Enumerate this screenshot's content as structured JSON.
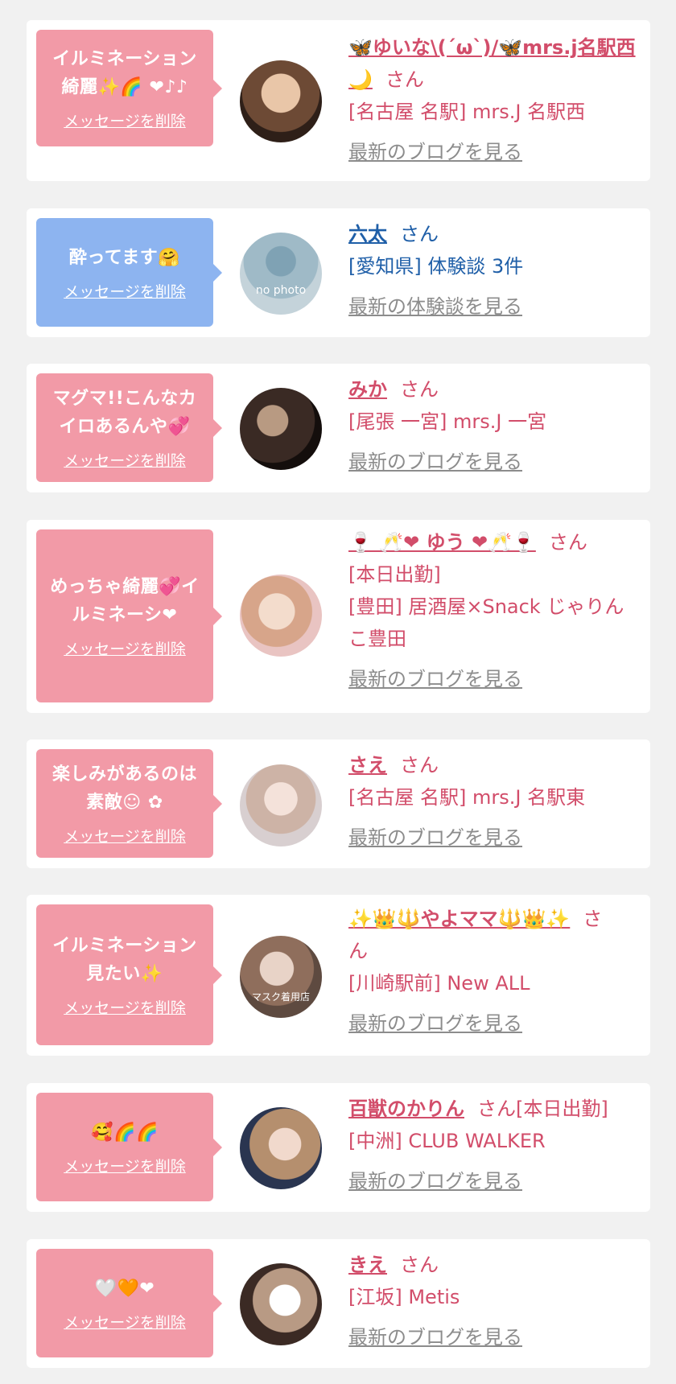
{
  "delete_label": "メッセージを削除",
  "items": [
    {
      "message": "イルミネーション綺麗✨🌈 ❤♪♪",
      "name": "🦋ゆいな\\(´ω`)/🦋mrs.j名駅西🌙",
      "san": "さん",
      "lines": [
        "[名古屋 名駅] mrs.J 名駅西"
      ],
      "link": "最新のブログを見る"
    },
    {
      "message": "酔ってます🤗",
      "name": "六太",
      "san": "さん",
      "lines": [
        "[愛知県] 体験談 3件"
      ],
      "link": "最新の体験談を見る",
      "avatar_text": "no photo"
    },
    {
      "message": "マグマ!!こんなカイロあるんや💞",
      "name": "みか",
      "san": "さん",
      "lines": [
        "[尾張 一宮] mrs.J 一宮"
      ],
      "link": "最新のブログを見る"
    },
    {
      "message": "めっちゃ綺麗💞イルミネーシ❤",
      "name": "🍷 🥂❤ ゆう ❤🥂🍷",
      "san": "さん",
      "lines": [
        "[本日出勤]",
        "[豊田] 居酒屋×Snack じゃりん",
        "こ豊田"
      ],
      "link": "最新のブログを見る"
    },
    {
      "message": "楽しみがあるのは素敵☺ ✿",
      "name": "さえ",
      "san": "さん",
      "lines": [
        "[名古屋 名駅] mrs.J 名駅東"
      ],
      "link": "最新のブログを見る"
    },
    {
      "message": "イルミネーション見たい✨",
      "name": "✨👑🔱やよママ🔱👑✨",
      "san": "さ",
      "san2": "ん",
      "lines": [
        "[川崎駅前] New ALL"
      ],
      "link": "最新のブログを見る",
      "avatar_text": "マスク着用店"
    },
    {
      "message": "🥰🌈🌈",
      "name": "百獣のかりん",
      "san": "さん[本日出勤]",
      "lines": [
        "[中洲] CLUB WALKER"
      ],
      "link": "最新のブログを見る"
    },
    {
      "message": "🤍🧡❤",
      "name": "きえ",
      "san": "さん",
      "lines": [
        "[江坂] Metis"
      ],
      "link": "最新のブログを見る"
    }
  ]
}
